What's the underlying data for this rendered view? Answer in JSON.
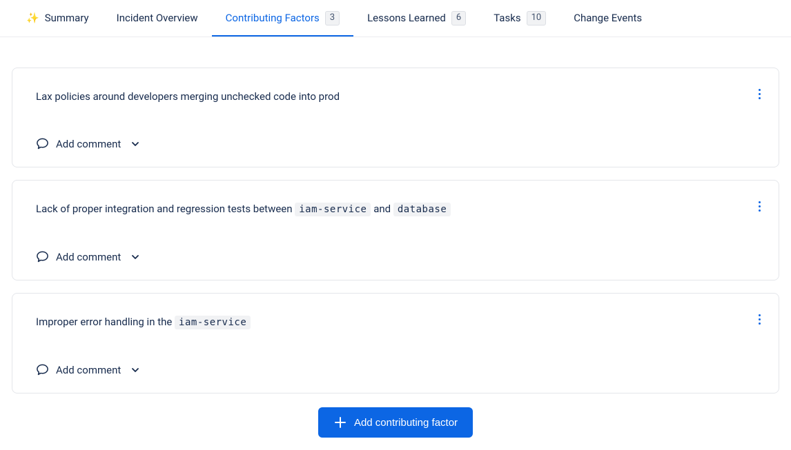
{
  "tabs": {
    "summary": {
      "label": "Summary"
    },
    "overview": {
      "label": "Incident Overview"
    },
    "contributing": {
      "label": "Contributing Factors",
      "count": "3",
      "active": true
    },
    "lessons": {
      "label": "Lessons Learned",
      "count": "6"
    },
    "tasks": {
      "label": "Tasks",
      "count": "10"
    },
    "events": {
      "label": "Change Events"
    }
  },
  "factors": [
    {
      "parts": [
        {
          "type": "text",
          "value": "Lax policies around developers merging unchecked code into prod"
        }
      ]
    },
    {
      "parts": [
        {
          "type": "text",
          "value": "Lack of proper integration and regression tests between "
        },
        {
          "type": "code",
          "value": "iam-service"
        },
        {
          "type": "text",
          "value": " and "
        },
        {
          "type": "code",
          "value": "database"
        }
      ]
    },
    {
      "parts": [
        {
          "type": "text",
          "value": "Improper error handling in the "
        },
        {
          "type": "code",
          "value": "iam-service"
        }
      ]
    }
  ],
  "labels": {
    "add_comment": "Add comment",
    "add_factor": "Add contributing factor"
  }
}
